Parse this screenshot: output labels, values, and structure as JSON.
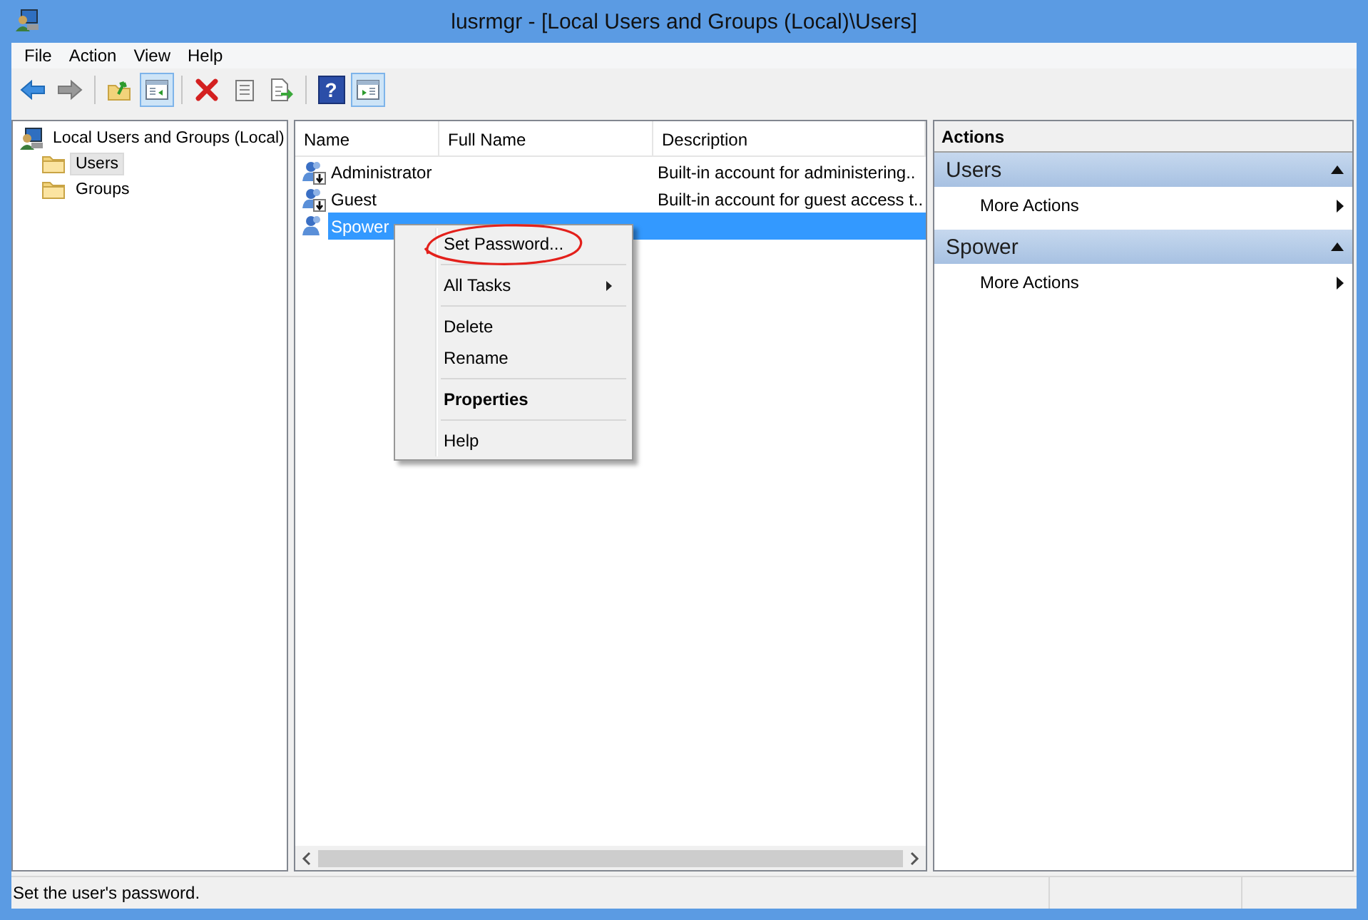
{
  "window": {
    "title": "lusrmgr - [Local Users and Groups (Local)\\Users]"
  },
  "menu_bar": [
    "File",
    "Action",
    "View",
    "Help"
  ],
  "toolbar": {
    "groups": [
      {
        "buttons": [
          {
            "kind": "back",
            "pressed": false,
            "disabled": false
          },
          {
            "kind": "forward",
            "pressed": false,
            "disabled": true
          }
        ]
      },
      {
        "buttons": [
          {
            "kind": "up",
            "pressed": false,
            "disabled": false
          },
          {
            "kind": "console_tree",
            "pressed": true,
            "disabled": false
          }
        ]
      },
      {
        "buttons": [
          {
            "kind": "delete",
            "pressed": false,
            "disabled": false
          },
          {
            "kind": "properties",
            "pressed": false,
            "disabled": false
          },
          {
            "kind": "export",
            "pressed": false,
            "disabled": false
          }
        ]
      },
      {
        "buttons": [
          {
            "kind": "help",
            "glyph": "?",
            "pressed": false,
            "disabled": false
          },
          {
            "kind": "action_pane",
            "pressed": true,
            "disabled": false
          }
        ]
      }
    ]
  },
  "tree": {
    "label": "Local Users and Groups (Local)",
    "children": [
      {
        "label": "Users",
        "selected": true
      },
      {
        "label": "Groups",
        "selected": false
      }
    ]
  },
  "list": {
    "columns": [
      "Name",
      "Full Name",
      "Description"
    ],
    "rows": [
      {
        "name": "Administrator",
        "description": "Built-in account for administering..",
        "disabled": true,
        "selected": false
      },
      {
        "name": "Guest",
        "description": "Built-in account for guest access t..",
        "disabled": true,
        "selected": false
      },
      {
        "name": "Spower",
        "disabled": false,
        "selected": true
      }
    ]
  },
  "context_menu": {
    "groups": [
      [
        {
          "label": "Set Password...",
          "submenu": false,
          "default": false
        }
      ],
      [
        {
          "label": "All Tasks",
          "submenu": true,
          "default": false
        }
      ],
      [
        {
          "label": "Delete",
          "submenu": false,
          "default": false
        },
        {
          "label": "Rename",
          "submenu": false,
          "default": false
        }
      ],
      [
        {
          "label": "Properties",
          "submenu": false,
          "default": true
        }
      ],
      [
        {
          "label": "Help",
          "submenu": false,
          "default": false
        }
      ]
    ]
  },
  "actions": {
    "title": "Actions",
    "sections": [
      {
        "title": "Users",
        "expanded": true,
        "items": [
          {
            "label": "More Actions",
            "submenu": true
          }
        ]
      },
      {
        "title": "Spower",
        "expanded": true,
        "items": [
          {
            "label": "More Actions",
            "submenu": true
          }
        ]
      }
    ]
  },
  "status_bar": {
    "text": "Set the user's password."
  }
}
